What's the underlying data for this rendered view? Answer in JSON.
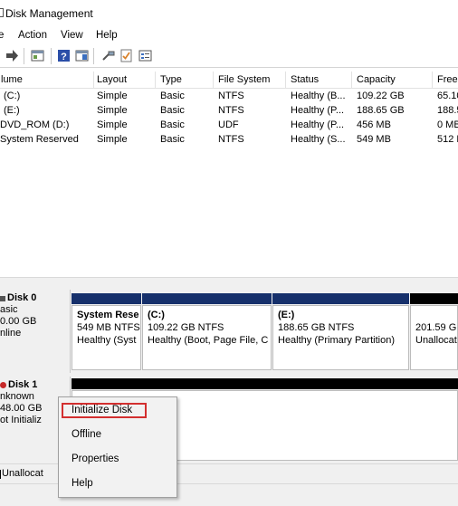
{
  "window": {
    "title": "Disk Management"
  },
  "menu": [
    "e",
    "Action",
    "View",
    "Help"
  ],
  "toolbar_icons": [
    "forward-arrow-icon",
    "console-icon",
    "help-icon",
    "show-hide-icon",
    "connect-icon",
    "checklist-icon",
    "properties-icon"
  ],
  "volume_table": {
    "columns": [
      "lume",
      "Layout",
      "Type",
      "File System",
      "Status",
      "Capacity",
      "Free"
    ],
    "rows": [
      [
        "(C:)",
        "Simple",
        "Basic",
        "NTFS",
        "Healthy (B...",
        "109.22 GB",
        "65.10"
      ],
      [
        "(E:)",
        "Simple",
        "Basic",
        "NTFS",
        "Healthy (P...",
        "188.65 GB",
        "188.5"
      ],
      [
        "DVD_ROM (D:)",
        "Simple",
        "Basic",
        "UDF",
        "Healthy (P...",
        "456 MB",
        "0 MB"
      ],
      [
        "System Reserved",
        "Simple",
        "Basic",
        "NTFS",
        "Healthy (S...",
        "549 MB",
        "512 M"
      ]
    ]
  },
  "disk0": {
    "name": "Disk 0",
    "type": "asic",
    "size": "0.00 GB",
    "state": "nline",
    "partitions": [
      {
        "name": "System Rese",
        "detail": "549 MB NTFS",
        "status": "Healthy (Syst"
      },
      {
        "name": "(C:)",
        "detail": "109.22 GB NTFS",
        "status": "Healthy (Boot, Page File, C"
      },
      {
        "name": "(E:)",
        "detail": "188.65 GB NTFS",
        "status": "Healthy (Primary Partition)"
      },
      {
        "name": "",
        "detail": "201.59 GB",
        "status": "Unallocat"
      }
    ]
  },
  "disk1": {
    "name": "Disk 1",
    "type": "nknown",
    "size": "48.00 GB",
    "state": "ot Initializ"
  },
  "context_menu": {
    "items": [
      "Initialize Disk",
      "Offline",
      "Properties",
      "Help"
    ],
    "highlighted": "Initialize Disk"
  },
  "legend": {
    "unallocated": "Unallocat"
  },
  "colors": {
    "primary_bar": "#16306b",
    "unallocated_bar": "#000000",
    "highlight_border": "#d32f2f"
  }
}
